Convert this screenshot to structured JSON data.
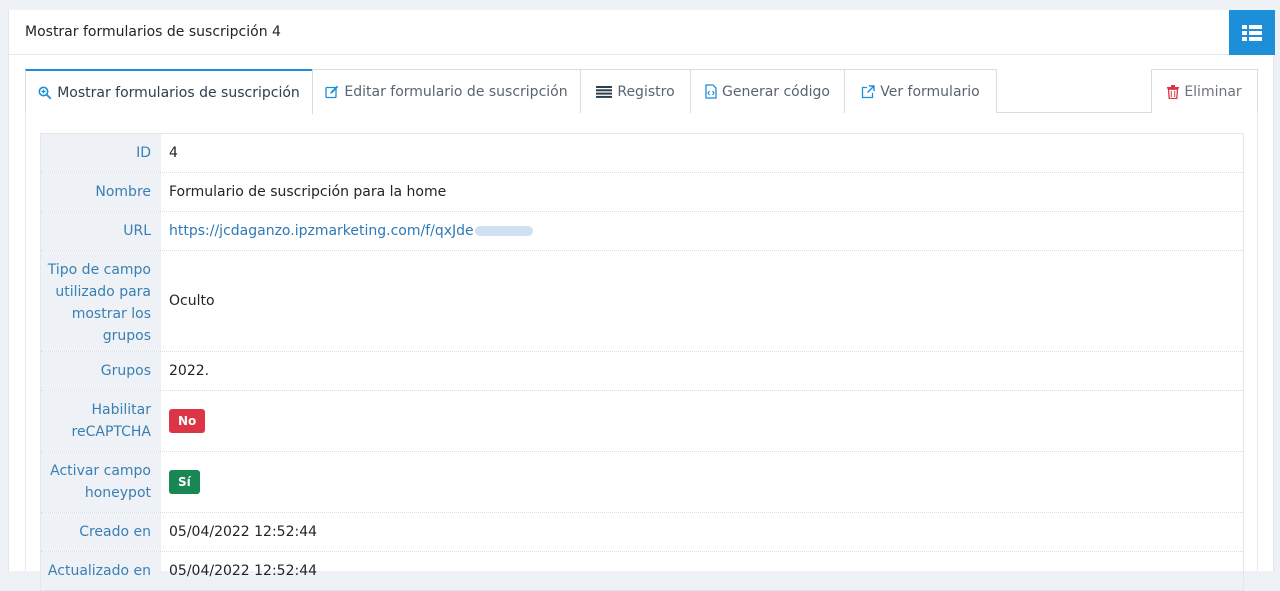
{
  "header": {
    "title": "Mostrar formularios de suscripción 4"
  },
  "tabs": [
    {
      "label": "Mostrar formularios de suscripción",
      "icon": "zoom-in-icon",
      "active": true
    },
    {
      "label": "Editar formulario de suscripción",
      "icon": "edit-icon"
    },
    {
      "label": "Registro",
      "icon": "list-lines-icon"
    },
    {
      "label": "Generar código",
      "icon": "code-file-icon"
    },
    {
      "label": "Ver formulario",
      "icon": "external-link-icon"
    }
  ],
  "delete_label": "Eliminar",
  "fields": {
    "id": {
      "label": "ID",
      "value": "4"
    },
    "nombre": {
      "label": "Nombre",
      "value": "Formulario de suscripción para la home"
    },
    "url": {
      "label": "URL",
      "value": "https://jcdaganzo.ipzmarketing.com/f/qxJde"
    },
    "tipo": {
      "label": "Tipo de campo utilizado para mostrar los grupos",
      "value": "Oculto"
    },
    "grupos": {
      "label": "Grupos",
      "value": "2022."
    },
    "recaptcha": {
      "label": "Habilitar reCAPTCHA",
      "value": "No"
    },
    "honeypot": {
      "label": "Activar campo honeypot",
      "value": "Sí"
    },
    "creado": {
      "label": "Creado en",
      "value": "05/04/2022 12:52:44"
    },
    "actualizado": {
      "label": "Actualizado en",
      "value": "05/04/2022 12:52:44"
    }
  },
  "colors": {
    "accent": "#1d8ed8",
    "danger": "#dc3545",
    "success": "#198754",
    "label_text": "#3a7fb3"
  }
}
